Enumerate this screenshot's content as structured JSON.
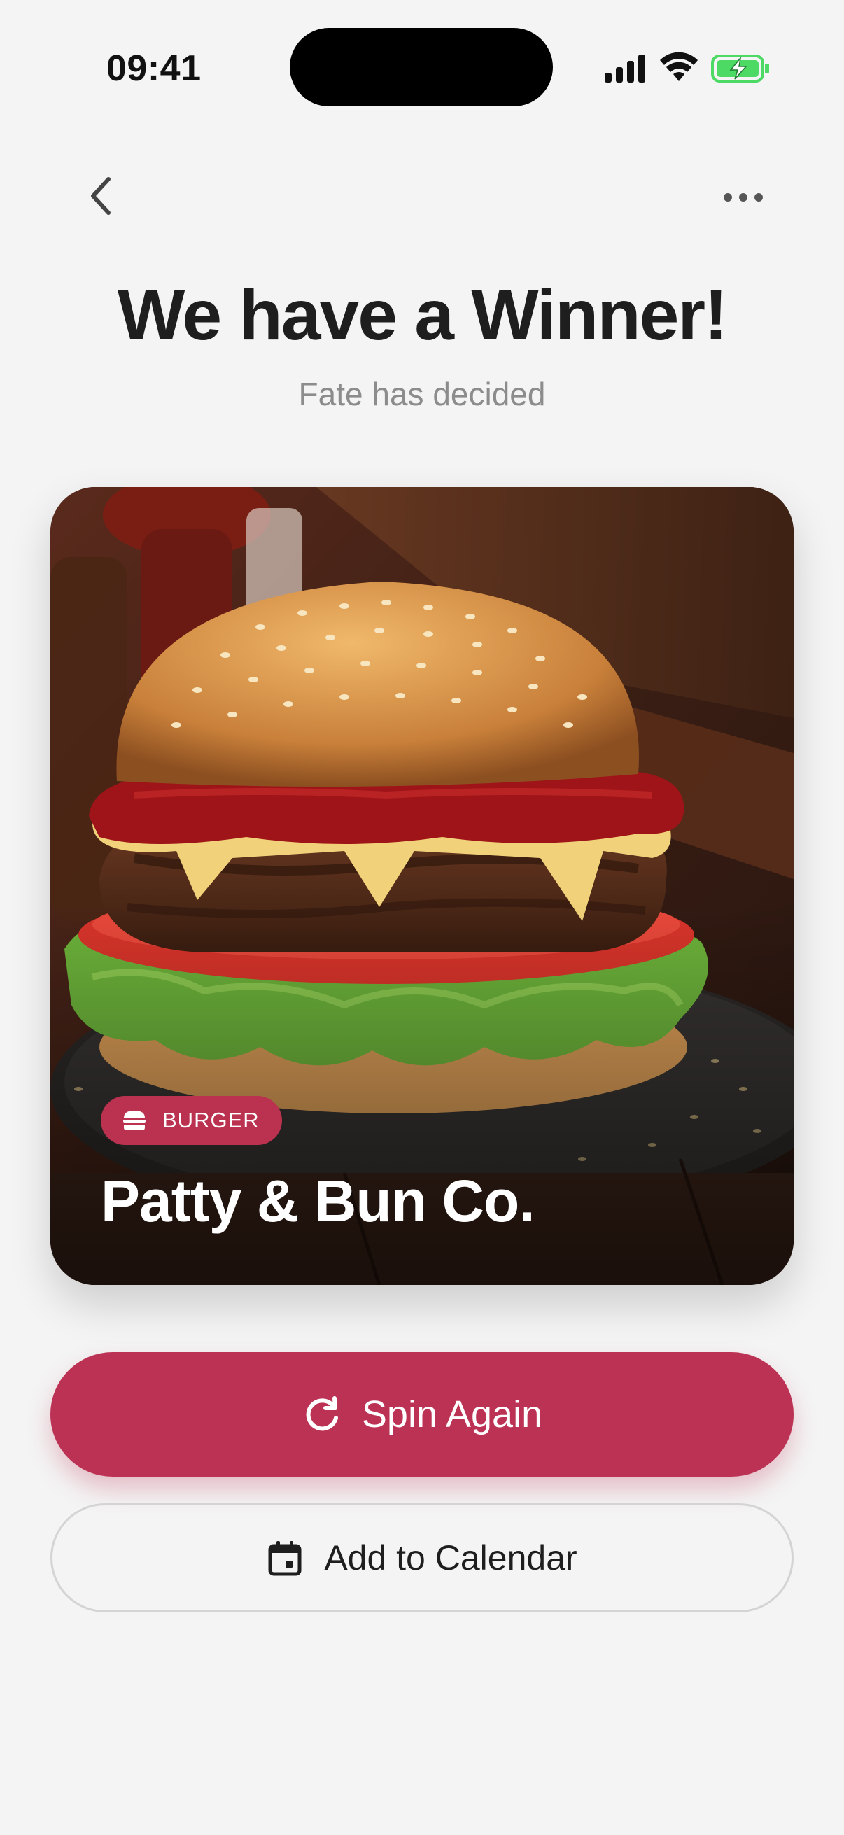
{
  "status_bar": {
    "time": "09:41"
  },
  "nav": {
    "back_icon": "chevron-left-icon",
    "more_icon": "more-horizontal-icon"
  },
  "header": {
    "title": "We have a Winner!",
    "subtitle": "Fate has decided"
  },
  "result_card": {
    "image": "burger-photo",
    "category": "BURGER",
    "category_icon": "burger-icon",
    "restaurant_name": "Patty & Bun Co."
  },
  "actions": {
    "spin_again_label": "Spin Again",
    "spin_icon": "refresh-icon",
    "add_to_calendar_label": "Add to Calendar",
    "calendar_icon": "calendar-icon"
  },
  "colors": {
    "accent": "#bc3254",
    "background": "#f4f4f4",
    "title_text": "#1e1e1e",
    "subtitle_text": "#8c8c8c",
    "battery_green": "#4cd964"
  }
}
